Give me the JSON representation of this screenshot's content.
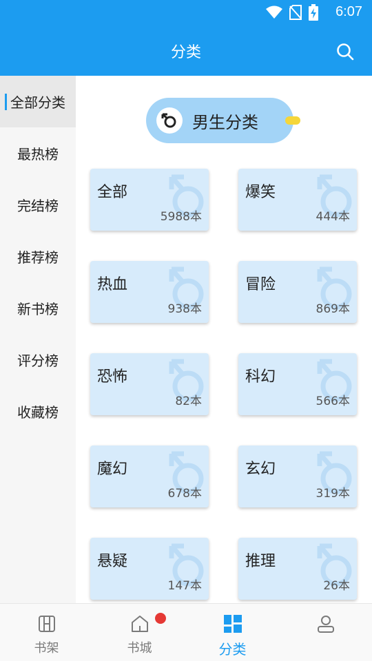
{
  "status_bar": {
    "time": "6:07"
  },
  "header": {
    "title": "分类"
  },
  "sidebar": {
    "items": [
      {
        "label": "全部分类",
        "active": true
      },
      {
        "label": "最热榜",
        "active": false
      },
      {
        "label": "完结榜",
        "active": false
      },
      {
        "label": "推荐榜",
        "active": false
      },
      {
        "label": "新书榜",
        "active": false
      },
      {
        "label": "评分榜",
        "active": false
      },
      {
        "label": "收藏榜",
        "active": false
      }
    ]
  },
  "main": {
    "gender_label": "男生分类",
    "categories": [
      {
        "name": "全部",
        "count": "5988本"
      },
      {
        "name": "爆笑",
        "count": "444本"
      },
      {
        "name": "热血",
        "count": "938本"
      },
      {
        "name": "冒险",
        "count": "869本"
      },
      {
        "name": "恐怖",
        "count": "82本"
      },
      {
        "name": "科幻",
        "count": "566本"
      },
      {
        "name": "魔幻",
        "count": "678本"
      },
      {
        "name": "玄幻",
        "count": "319本"
      },
      {
        "name": "悬疑",
        "count": "147本"
      },
      {
        "name": "推理",
        "count": "26本"
      }
    ]
  },
  "bottom_nav": {
    "items": [
      {
        "label": "书架",
        "icon": "bookshelf-icon",
        "active": false
      },
      {
        "label": "书城",
        "icon": "home-icon",
        "active": false
      },
      {
        "label": "分类",
        "icon": "category-grid-icon",
        "active": true
      },
      {
        "label": "",
        "icon": "profile-icon",
        "active": false
      }
    ]
  },
  "colors": {
    "accent": "#1c9cf0",
    "card_bg": "#d7ebfb",
    "pill_bg": "#a3d4f7",
    "badge": "#e53935"
  }
}
